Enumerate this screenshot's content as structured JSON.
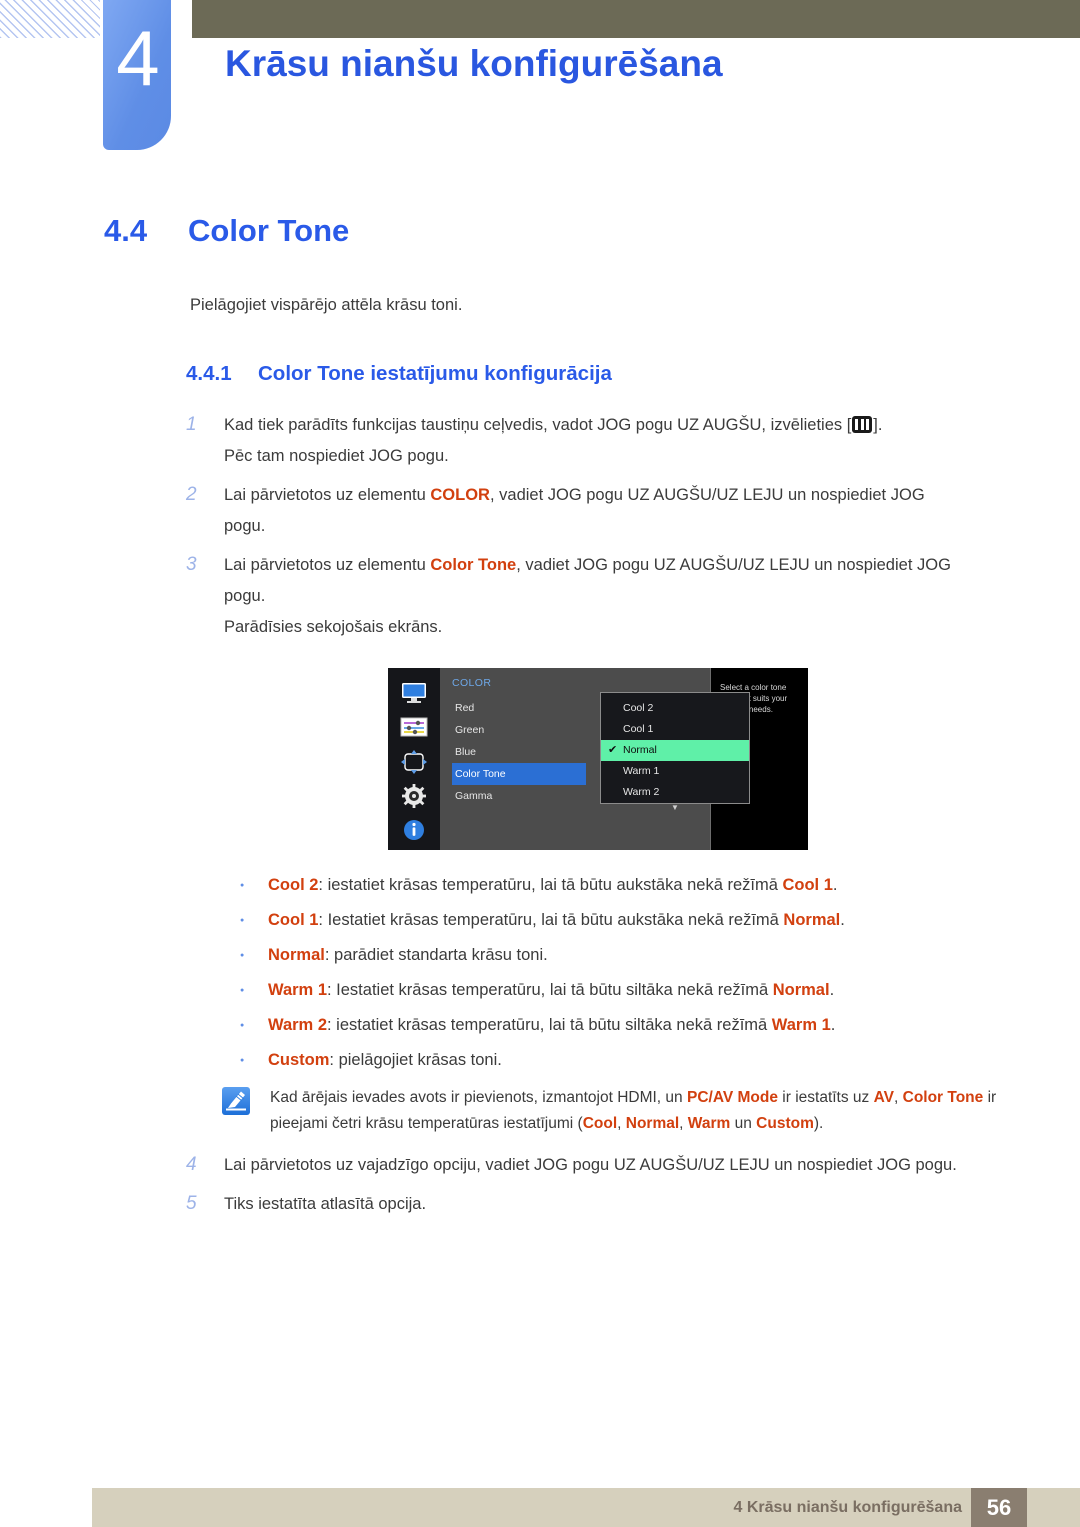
{
  "header": {
    "chapter_number": "4",
    "chapter_title": "Krāsu nianšu konfigurēšana",
    "olive_color": "#6c6a56",
    "tab_color": "#5f8ee6",
    "title_color": "#2a57e0"
  },
  "section": {
    "number": "4.4",
    "title": "Color Tone",
    "intro": "Pielāgojiet vispārējo attēla krāsu toni."
  },
  "subsection": {
    "number": "4.4.1",
    "title": "Color Tone iestatījumu konfigurācija"
  },
  "steps": [
    {
      "num": "1",
      "lines": [
        {
          "parts": [
            {
              "t": "Kad tiek parādīts funkcijas taustiņu ceļvedis, vadot JOG pogu UZ AUGŠU, izvēlieties [",
              "kw": false
            },
            {
              "t": "key-icon",
              "icon": true
            },
            {
              "t": "].",
              "kw": false
            }
          ]
        },
        {
          "parts": [
            {
              "t": "Pēc tam nospiediet JOG pogu.",
              "kw": false
            }
          ]
        }
      ]
    },
    {
      "num": "2",
      "lines": [
        {
          "parts": [
            {
              "t": "Lai pārvietotos uz elementu ",
              "kw": false
            },
            {
              "t": "COLOR",
              "kw": true
            },
            {
              "t": ", vadiet JOG pogu UZ AUGŠU/UZ LEJU un nospiediet JOG",
              "kw": false
            }
          ]
        },
        {
          "parts": [
            {
              "t": "pogu.",
              "kw": false
            }
          ]
        }
      ]
    },
    {
      "num": "3",
      "lines": [
        {
          "parts": [
            {
              "t": "Lai pārvietotos uz elementu ",
              "kw": false
            },
            {
              "t": "Color Tone",
              "kw": true
            },
            {
              "t": ", vadiet JOG pogu UZ AUGŠU/UZ LEJU un nospiediet JOG",
              "kw": false
            }
          ]
        },
        {
          "parts": [
            {
              "t": "pogu.",
              "kw": false
            }
          ]
        },
        {
          "parts": [
            {
              "t": "Parādīsies sekojošais ekrāns.",
              "kw": false
            }
          ]
        }
      ]
    }
  ],
  "osd": {
    "icons": [
      "monitor-icon",
      "sliders-icon",
      "resize-arrows-icon",
      "gear-icon",
      "info-icon"
    ],
    "category": "COLOR",
    "items": [
      {
        "label": "Red",
        "selected": false
      },
      {
        "label": "Green",
        "selected": false
      },
      {
        "label": "Blue",
        "selected": false
      },
      {
        "label": "Color Tone",
        "selected": true
      },
      {
        "label": "Gamma",
        "selected": false
      }
    ],
    "options": [
      {
        "label": "Cool 2",
        "checked": false
      },
      {
        "label": "Cool 1",
        "checked": false
      },
      {
        "label": "Normal",
        "checked": true
      },
      {
        "label": "Warm 1",
        "checked": false
      },
      {
        "label": "Warm 2",
        "checked": false
      }
    ],
    "scroll_caret": "▼",
    "check_mark": "✔",
    "help_text": "Select a color tone that best suits your viewing needs.",
    "highlight_color": "#2b6fd4",
    "option_highlight_color": "#5ff0a8"
  },
  "bullets": [
    {
      "parts": [
        {
          "t": "Cool 2",
          "kw": true
        },
        {
          "t": ": iestatiet krāsas temperatūru, lai tā būtu aukstāka nekā režīmā ",
          "kw": false
        },
        {
          "t": "Cool 1",
          "kw": true
        },
        {
          "t": ".",
          "kw": false
        }
      ]
    },
    {
      "parts": [
        {
          "t": "Cool 1",
          "kw": true
        },
        {
          "t": ": Iestatiet krāsas temperatūru, lai tā būtu aukstāka nekā režīmā ",
          "kw": false
        },
        {
          "t": "Normal",
          "kw": true
        },
        {
          "t": ".",
          "kw": false
        }
      ]
    },
    {
      "parts": [
        {
          "t": "Normal",
          "kw": true
        },
        {
          "t": ": parādiet standarta krāsu toni.",
          "kw": false
        }
      ]
    },
    {
      "parts": [
        {
          "t": "Warm 1",
          "kw": true
        },
        {
          "t": ": Iestatiet krāsas temperatūru, lai tā būtu siltāka nekā režīmā ",
          "kw": false
        },
        {
          "t": "Normal",
          "kw": true
        },
        {
          "t": ".",
          "kw": false
        }
      ]
    },
    {
      "parts": [
        {
          "t": "Warm 2",
          "kw": true
        },
        {
          "t": ": iestatiet krāsas temperatūru, lai tā būtu siltāka nekā režīmā ",
          "kw": false
        },
        {
          "t": "Warm 1",
          "kw": true
        },
        {
          "t": ".",
          "kw": false
        }
      ]
    },
    {
      "parts": [
        {
          "t": "Custom",
          "kw": true
        },
        {
          "t": ": pielāgojiet krāsas toni.",
          "kw": false
        }
      ]
    }
  ],
  "note": {
    "icon": "note-pen-icon",
    "parts": [
      {
        "t": "Kad ārējais ievades avots ir pievienots, izmantojot HDMI, un ",
        "kw": false
      },
      {
        "t": "PC/AV Mode",
        "kw": true
      },
      {
        "t": " ir iestatīts uz ",
        "kw": false
      },
      {
        "t": "AV",
        "kw": true
      },
      {
        "t": ", ",
        "kw": false
      },
      {
        "t": "Color Tone",
        "kw": true
      },
      {
        "t": " ir pieejami četri krāsu temperatūras iestatījumi (",
        "kw": false
      },
      {
        "t": "Cool",
        "kw": true
      },
      {
        "t": ", ",
        "kw": false
      },
      {
        "t": "Normal",
        "kw": true
      },
      {
        "t": ", ",
        "kw": false
      },
      {
        "t": "Warm",
        "kw": true
      },
      {
        "t": " un ",
        "kw": false
      },
      {
        "t": "Custom",
        "kw": true
      },
      {
        "t": ").",
        "kw": false
      }
    ]
  },
  "steps2": [
    {
      "num": "4",
      "lines": [
        {
          "parts": [
            {
              "t": "Lai pārvietotos uz vajadzīgo opciju, vadiet JOG pogu UZ AUGŠU/UZ LEJU un nospiediet JOG pogu.",
              "kw": false
            }
          ]
        }
      ]
    },
    {
      "num": "5",
      "lines": [
        {
          "parts": [
            {
              "t": "Tiks iestatīta atlasītā opcija.",
              "kw": false
            }
          ]
        }
      ]
    }
  ],
  "footer": {
    "text": "4 Krāsu nianšu konfigurēšana",
    "page": "56",
    "bar_color": "#d6d0bd",
    "page_box_color": "#8a7e70"
  }
}
